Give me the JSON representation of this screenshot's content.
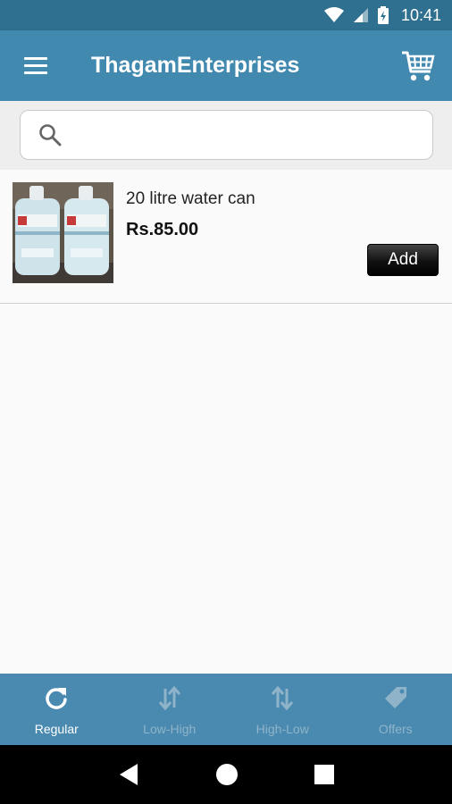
{
  "status_bar": {
    "time": "10:41"
  },
  "app_bar": {
    "title": "ThagamEnterprises"
  },
  "search": {
    "placeholder": "",
    "value": ""
  },
  "products": [
    {
      "name": "20 litre water can",
      "price": "Rs.85.00",
      "add_label": "Add"
    }
  ],
  "bottom_nav": {
    "items": [
      {
        "label": "Regular",
        "icon": "refresh-icon",
        "active": true
      },
      {
        "label": "Low-High",
        "icon": "sort-low-high-icon",
        "active": false
      },
      {
        "label": "High-Low",
        "icon": "sort-high-low-icon",
        "active": false
      },
      {
        "label": "Offers",
        "icon": "tag-icon",
        "active": false
      }
    ]
  },
  "colors": {
    "status_bar": "#2f6f8f",
    "app_bar": "#4289b0",
    "bottom_nav": "#4a8ab0",
    "inactive_label": "#8fb3c9"
  }
}
